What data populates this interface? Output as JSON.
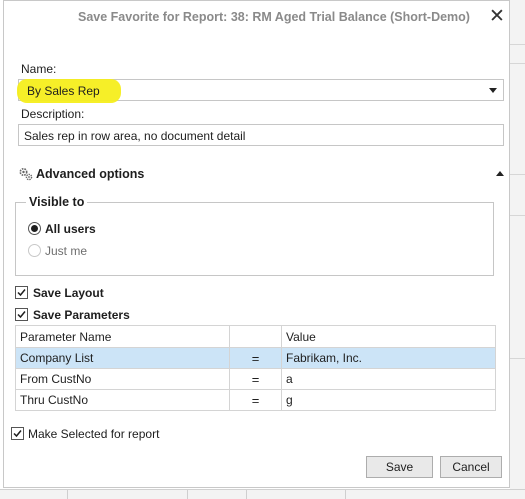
{
  "dialog": {
    "title": "Save Favorite for Report: 38: RM Aged Trial Balance (Short-Demo)",
    "close_glyph": "✕"
  },
  "name": {
    "label": "Name:",
    "value": "By Sales Rep",
    "highlight_color": "#f5ee1c"
  },
  "description": {
    "label": "Description:",
    "value": "Sales rep in row area, no document detail"
  },
  "advanced": {
    "label": "Advanced options",
    "icon": "gears-icon",
    "expanded": true,
    "visible_to": {
      "title": "Visible to",
      "options": [
        {
          "label": "All users",
          "checked": true
        },
        {
          "label": "Just me",
          "checked": false
        }
      ]
    },
    "save_layout": {
      "label": "Save Layout",
      "checked": true
    },
    "save_parameters": {
      "label": "Save Parameters",
      "checked": true
    }
  },
  "parameters": {
    "columns": [
      "Parameter Name",
      "",
      "Value"
    ],
    "rows": [
      {
        "name": "Company List",
        "op": "=",
        "value": "Fabrikam, Inc.",
        "selected": true
      },
      {
        "name": "From CustNo",
        "op": "=",
        "value": "a",
        "selected": false
      },
      {
        "name": "Thru CustNo",
        "op": "=",
        "value": "g",
        "selected": false
      }
    ],
    "selected_color": "#cce4f7"
  },
  "make_selected": {
    "label": "Make Selected for report",
    "checked": true
  },
  "buttons": {
    "save": "Save",
    "cancel": "Cancel"
  }
}
